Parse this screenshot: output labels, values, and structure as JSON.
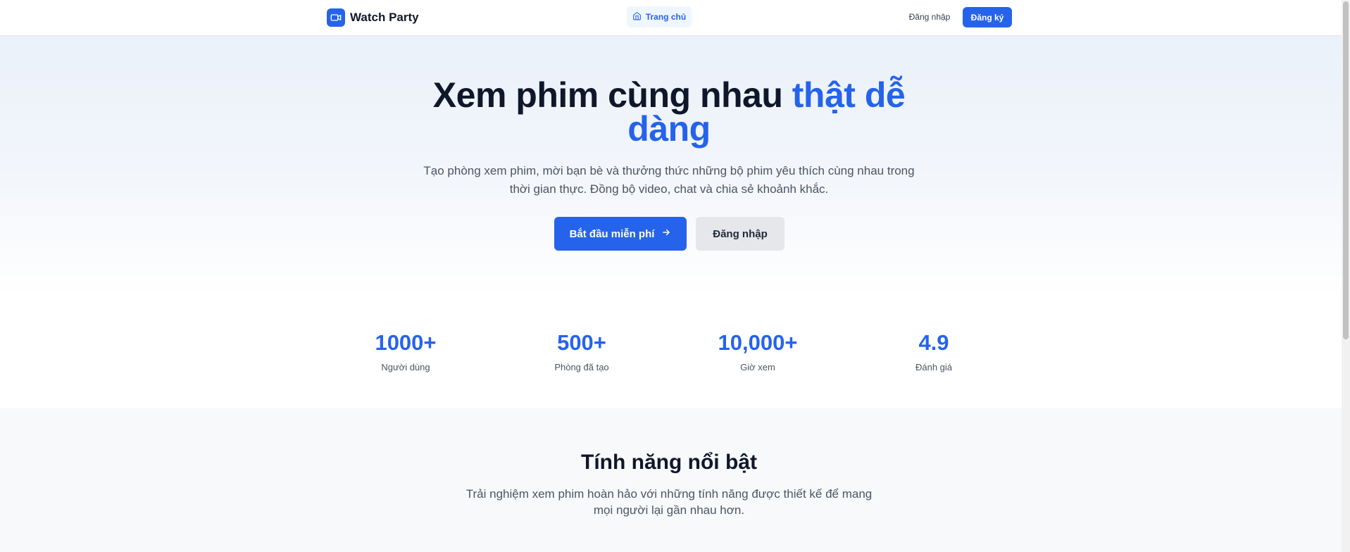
{
  "header": {
    "brand": "Watch Party",
    "nav_home": "Trang chủ",
    "login": "Đăng nhập",
    "register": "Đăng ký"
  },
  "hero": {
    "title_main": "Xem phim cùng nhau ",
    "title_accent": "thật dễ dàng",
    "subtitle": "Tạo phòng xem phim, mời bạn bè và thưởng thức những bộ phim yêu thích cùng nhau trong thời gian thực. Đồng bộ video, chat và chia sẻ khoảnh khắc.",
    "primary_cta": "Bắt đầu miễn phí",
    "secondary_cta": "Đăng nhập"
  },
  "stats": [
    {
      "value": "1000+",
      "label": "Người dùng"
    },
    {
      "value": "500+",
      "label": "Phòng đã tạo"
    },
    {
      "value": "10,000+",
      "label": "Giờ xem"
    },
    {
      "value": "4.9",
      "label": "Đánh giá"
    }
  ],
  "features": {
    "title": "Tính năng nổi bật",
    "subtitle": "Trải nghiệm xem phim hoàn hảo với những tính năng được thiết kế để mang mọi người lại gần nhau hơn."
  },
  "colors": {
    "accent": "#2563eb",
    "text": "#0f172a",
    "muted": "#4b5563"
  },
  "icons": {
    "brand": "video-camera-icon",
    "home": "home-icon",
    "cta": "arrow-right-icon"
  }
}
